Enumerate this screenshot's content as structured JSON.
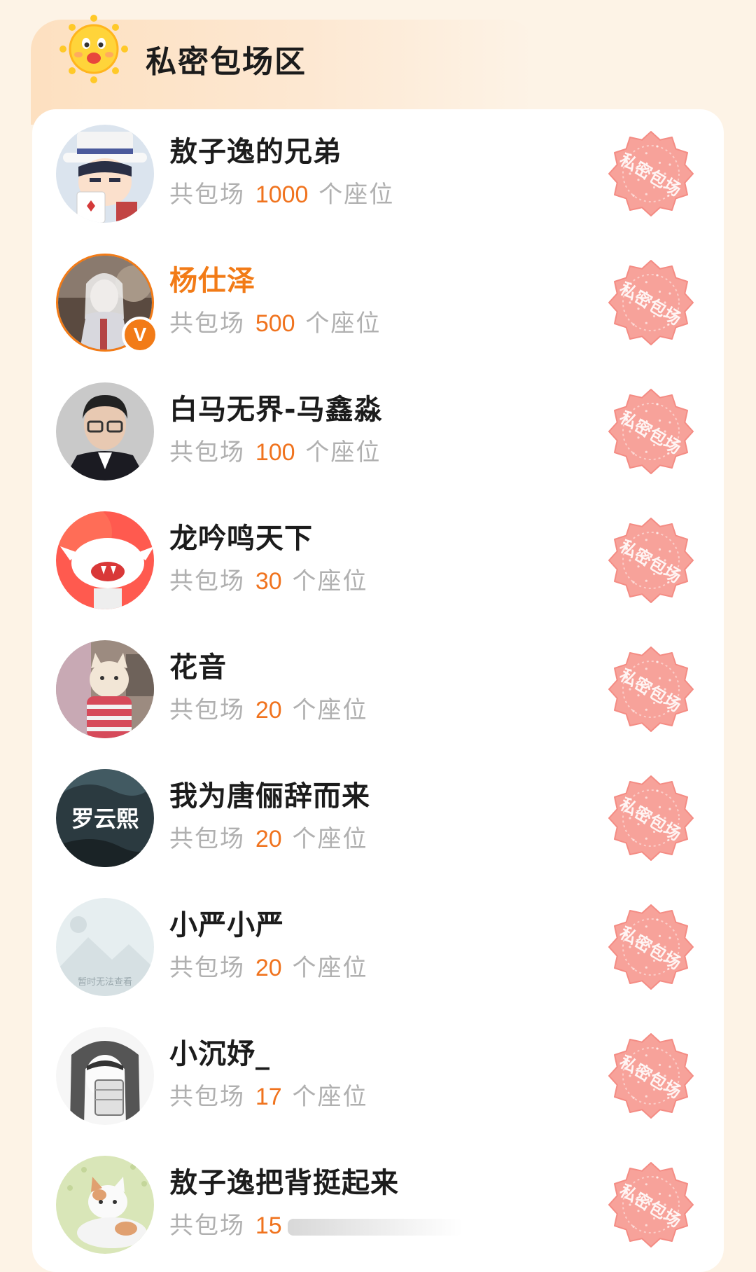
{
  "section": {
    "title": "私密包场区",
    "icon": "sun-mascot-icon",
    "accent_color": "#f27b17"
  },
  "stamp_label": "私密包场",
  "sub_prefix": "共包场",
  "sub_suffix": "个座位",
  "rows": [
    {
      "name": "敖子逸的兄弟",
      "seats": "1000",
      "verified": false,
      "avatar": "anime-magician-avatar"
    },
    {
      "name": "杨仕泽",
      "seats": "500",
      "verified": true,
      "avatar": "costume-actor-avatar"
    },
    {
      "name": "白马无界-马鑫淼",
      "seats": "100",
      "verified": false,
      "avatar": "man-with-glasses-avatar"
    },
    {
      "name": "龙吟鸣天下",
      "seats": "30",
      "verified": false,
      "avatar": "cartoon-ghost-avatar"
    },
    {
      "name": "花音",
      "seats": "20",
      "verified": false,
      "avatar": "cat-in-sweater-avatar"
    },
    {
      "name": "我为唐俪辞而来",
      "seats": "20",
      "verified": false,
      "avatar": "calligraphy-poster-avatar",
      "avatar_text": "罗云熙"
    },
    {
      "name": "小严小严",
      "seats": "20",
      "verified": false,
      "avatar": "unavailable-image-avatar",
      "avatar_text": "暂时无法查看"
    },
    {
      "name": "小沉妤_",
      "seats": "17",
      "verified": false,
      "avatar": "manga-girl-avatar"
    },
    {
      "name": "敖子逸把背挺起来",
      "seats": "15",
      "verified": false,
      "avatar": "white-cat-avatar"
    }
  ]
}
